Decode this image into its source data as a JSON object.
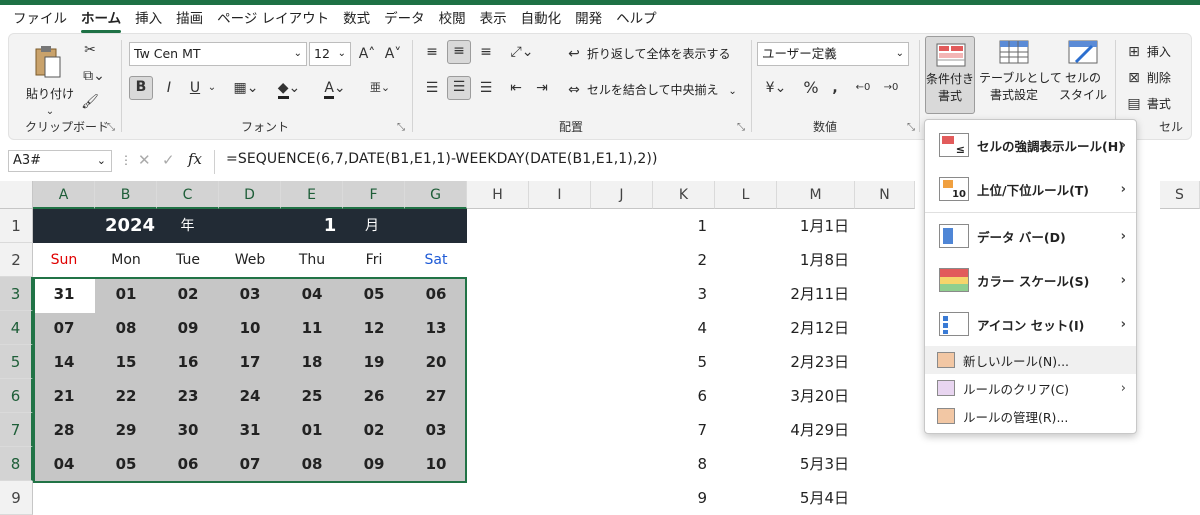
{
  "tabs": [
    "ファイル",
    "ホーム",
    "挿入",
    "描画",
    "ページ レイアウト",
    "数式",
    "データ",
    "校閲",
    "表示",
    "自動化",
    "開発",
    "ヘルプ"
  ],
  "active_tab": "ホーム",
  "ribbon": {
    "clipboard": {
      "paste": "貼り付け",
      "label": "クリップボード"
    },
    "font": {
      "name": "Tw Cen MT",
      "size": "12",
      "bold": "B",
      "italic": "I",
      "underline": "U",
      "label": "フォント"
    },
    "alignment": {
      "wrap": "折り返して全体を表示する",
      "merge": "セルを結合して中央揃え",
      "label": "配置"
    },
    "number": {
      "format": "ユーザー定義",
      "percent": "%",
      "label": "数値"
    },
    "styles": {
      "conditional_line1": "条件付き",
      "conditional_line2": "書式",
      "table_line1": "テーブルとして",
      "table_line2": "書式設定",
      "cell_line1": "セルの",
      "cell_line2": "スタイル"
    },
    "cells": {
      "insert": "挿入",
      "delete": "削除",
      "format": "書式",
      "label": "セル"
    }
  },
  "formula_bar": {
    "name_box": "A3#",
    "fx": "fx",
    "formula": "=SEQUENCE(6,7,DATE(B1,E1,1)-WEEKDAY(DATE(B1,E1,1),2))"
  },
  "columns": [
    "A",
    "B",
    "C",
    "D",
    "E",
    "F",
    "G",
    "H",
    "I",
    "J",
    "K",
    "L",
    "M",
    "N",
    "S"
  ],
  "rows": [
    "1",
    "2",
    "3",
    "4",
    "5",
    "6",
    "7",
    "8",
    "9"
  ],
  "calendar": {
    "year": "2024",
    "year_unit": "年",
    "month": "1",
    "month_unit": "月",
    "weekdays": [
      "Sun",
      "Mon",
      "Tue",
      "Web",
      "Thu",
      "Fri",
      "Sat"
    ],
    "weeks": [
      [
        "31",
        "01",
        "02",
        "03",
        "04",
        "05",
        "06"
      ],
      [
        "07",
        "08",
        "09",
        "10",
        "11",
        "12",
        "13"
      ],
      [
        "14",
        "15",
        "16",
        "17",
        "18",
        "19",
        "20"
      ],
      [
        "21",
        "22",
        "23",
        "24",
        "25",
        "26",
        "27"
      ],
      [
        "28",
        "29",
        "30",
        "31",
        "01",
        "02",
        "03"
      ],
      [
        "04",
        "05",
        "06",
        "07",
        "08",
        "09",
        "10"
      ]
    ]
  },
  "holidays": {
    "numbers": [
      "1",
      "2",
      "3",
      "4",
      "5",
      "6",
      "7",
      "8",
      "9"
    ],
    "dates": [
      "1月1日",
      "1月8日",
      "2月11日",
      "2月12日",
      "2月23日",
      "3月20日",
      "4月29日",
      "5月3日",
      "5月4日"
    ]
  },
  "menu": {
    "items": [
      "セルの強調表示ルール(H)",
      "上位/下位ルール(T)",
      "データ バー(D)",
      "カラー スケール(S)",
      "アイコン セット(I)"
    ],
    "actions": [
      "新しいルール(N)...",
      "ルールのクリア(C)",
      "ルールの管理(R)..."
    ]
  },
  "colors": {
    "accent": "#217346",
    "calendar_header": "#222b35",
    "sunday": "#e00000",
    "saturday": "#1f5bd6",
    "selection": "#c6c6c6"
  }
}
